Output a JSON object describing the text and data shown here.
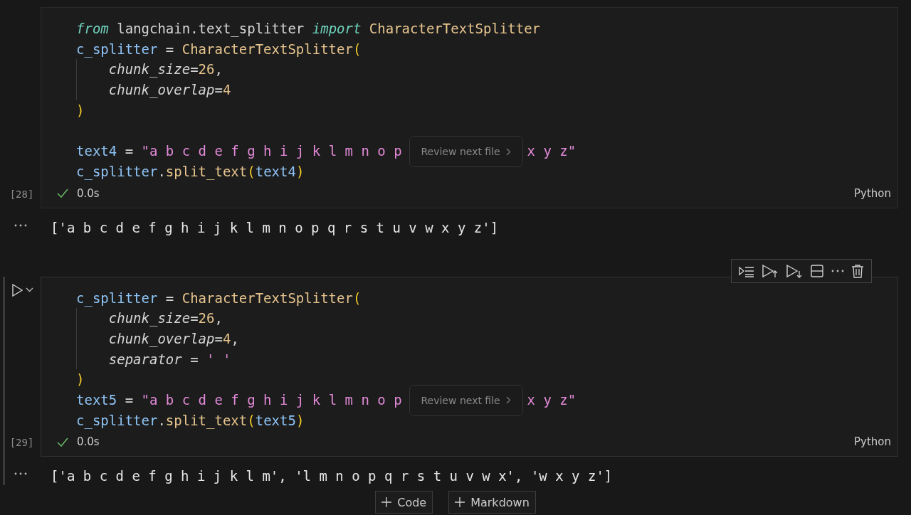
{
  "cells": [
    {
      "selected": false,
      "execution_count": "[28]",
      "succeeded": true,
      "time": "0.0s",
      "language": "Python",
      "lines": [
        {
          "tokens": [
            {
              "kind": "keyword",
              "text": "from"
            },
            {
              "kind": "plain",
              "text": " langchain.text_splitter "
            },
            {
              "kind": "keyword",
              "text": "import"
            },
            {
              "kind": "class",
              "text": "CharacterTextSplitter",
              "space_before": true
            }
          ]
        },
        {
          "tokens": [
            {
              "kind": "var",
              "text": "c_splitter"
            },
            {
              "kind": "plain",
              "text": " = "
            },
            {
              "kind": "class",
              "text": "CharacterTextSplitter"
            },
            {
              "kind": "paren",
              "text": "("
            }
          ]
        },
        {
          "indent": true,
          "tokens": [
            {
              "kind": "param",
              "text": "chunk_size"
            },
            {
              "kind": "plain",
              "text": "="
            },
            {
              "kind": "num",
              "text": "26"
            },
            {
              "kind": "plain",
              "text": ","
            }
          ]
        },
        {
          "indent": true,
          "tokens": [
            {
              "kind": "param",
              "text": "chunk_overlap"
            },
            {
              "kind": "plain",
              "text": "="
            },
            {
              "kind": "num",
              "text": "4"
            }
          ]
        },
        {
          "tokens": [
            {
              "kind": "paren",
              "text": ")"
            }
          ]
        },
        {
          "blank_before": true,
          "tokens": [
            {
              "kind": "var",
              "text": "text4"
            },
            {
              "kind": "plain",
              "text": " = "
            },
            {
              "kind": "str",
              "text": "\"a b c d e f g h i j k l m n o p"
            },
            {
              "kind": "popup",
              "text": "Review next file"
            },
            {
              "kind": "str",
              "text": "x y z\""
            }
          ]
        },
        {
          "tokens": [
            {
              "kind": "var",
              "text": "c_splitter"
            },
            {
              "kind": "plain",
              "text": "."
            },
            {
              "kind": "func",
              "text": "split_text"
            },
            {
              "kind": "paren",
              "text": "("
            },
            {
              "kind": "var",
              "text": "text4"
            },
            {
              "kind": "paren",
              "text": ")"
            }
          ]
        }
      ],
      "output": "['a b c d e f g h i j k l m n o p q r s t u v w x y z']"
    },
    {
      "selected": true,
      "execution_count": "[29]",
      "succeeded": true,
      "time": "0.0s",
      "language": "Python",
      "lines": [
        {
          "tokens": [
            {
              "kind": "var",
              "text": "c_splitter"
            },
            {
              "kind": "plain",
              "text": " = "
            },
            {
              "kind": "class",
              "text": "CharacterTextSplitter"
            },
            {
              "kind": "paren",
              "text": "("
            }
          ]
        },
        {
          "indent": true,
          "tokens": [
            {
              "kind": "param",
              "text": "chunk_size"
            },
            {
              "kind": "plain",
              "text": "="
            },
            {
              "kind": "num",
              "text": "26"
            },
            {
              "kind": "plain",
              "text": ","
            }
          ]
        },
        {
          "indent": true,
          "tokens": [
            {
              "kind": "param",
              "text": "chunk_overlap"
            },
            {
              "kind": "plain",
              "text": "="
            },
            {
              "kind": "num",
              "text": "4"
            },
            {
              "kind": "plain",
              "text": ","
            }
          ]
        },
        {
          "indent": true,
          "tokens": [
            {
              "kind": "param",
              "text": "separator"
            },
            {
              "kind": "plain",
              "text": " = "
            },
            {
              "kind": "str",
              "text": "' '"
            }
          ]
        },
        {
          "tokens": [
            {
              "kind": "paren",
              "text": ")"
            }
          ]
        },
        {
          "tokens": [
            {
              "kind": "var",
              "text": "text5"
            },
            {
              "kind": "plain",
              "text": " = "
            },
            {
              "kind": "str",
              "text": "\"a b c d e f g h i j k l m n o p"
            },
            {
              "kind": "popup",
              "text": "Review next file"
            },
            {
              "kind": "str",
              "text": "x y z\""
            }
          ]
        },
        {
          "tokens": [
            {
              "kind": "var",
              "text": "c_splitter"
            },
            {
              "kind": "plain",
              "text": "."
            },
            {
              "kind": "func",
              "text": "split_text"
            },
            {
              "kind": "paren",
              "text": "("
            },
            {
              "kind": "var",
              "text": "text5"
            },
            {
              "kind": "paren",
              "text": ")"
            }
          ]
        }
      ],
      "output": "['a b c d e f g h i j k l m', 'l m n o p q r s t u v w x', 'w x y z']"
    }
  ],
  "add_buttons": [
    "Code",
    "Markdown"
  ]
}
